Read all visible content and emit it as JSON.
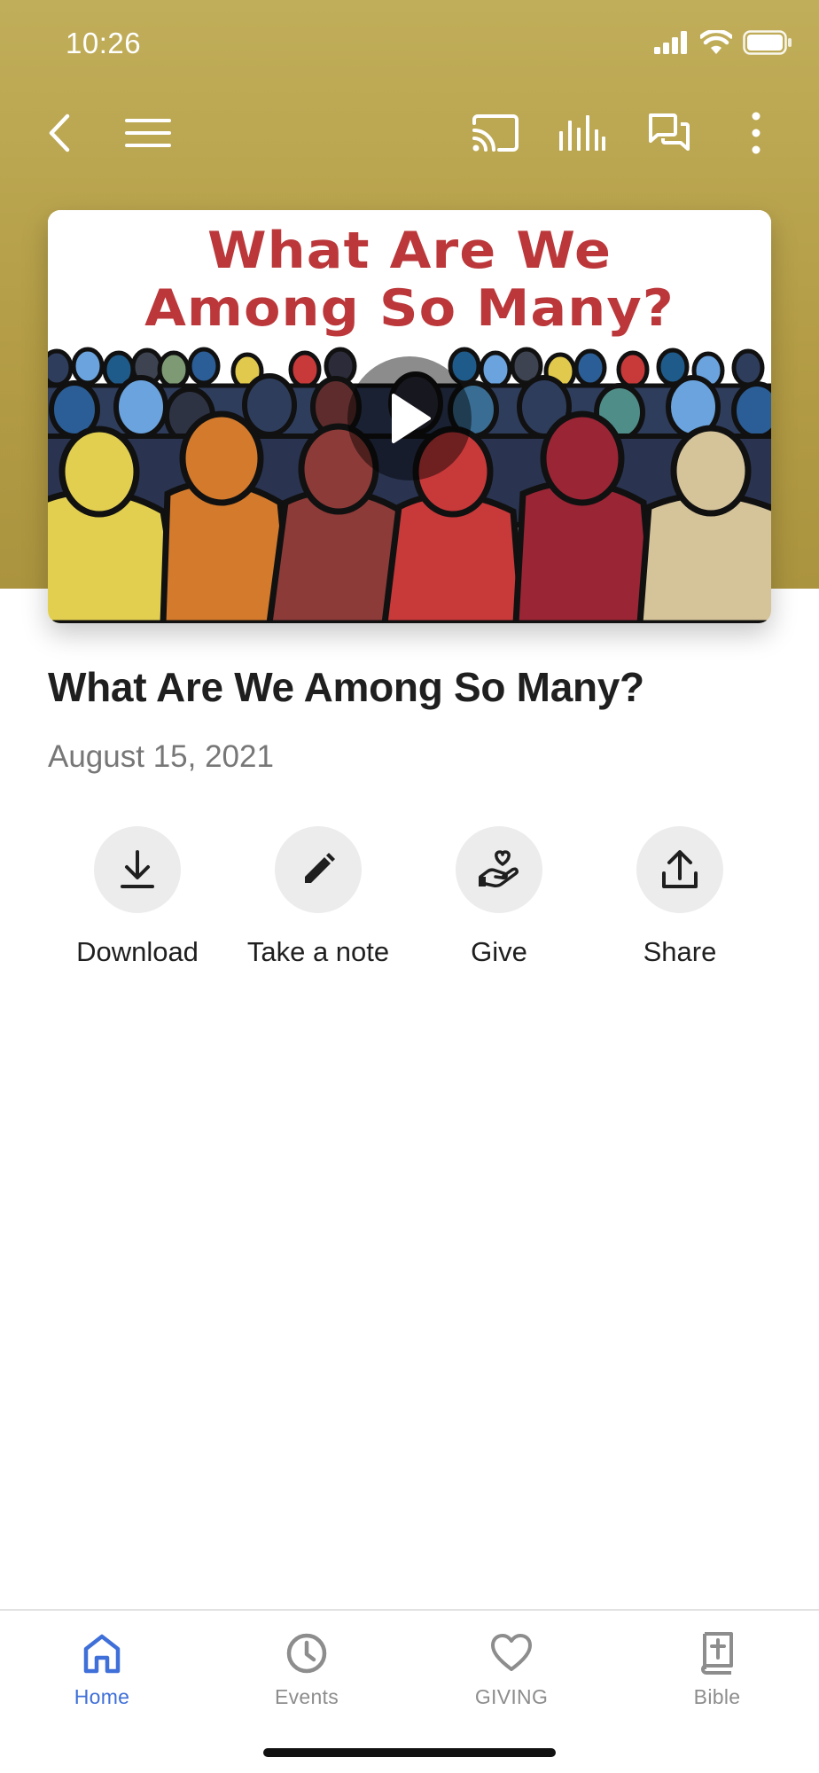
{
  "status_bar": {
    "time": "10:26"
  },
  "toolbar": {
    "back_icon": "chevron-left-icon",
    "menu_icon": "hamburger-menu-icon",
    "cast_icon": "cast-icon",
    "audio_icon": "audio-bars-icon",
    "chat_icon": "chat-bubbles-icon",
    "more_icon": "more-vertical-icon"
  },
  "video": {
    "thumbnail_text_line1": "What Are We",
    "thumbnail_text_line2": "Among So Many?",
    "play_icon": "play-icon"
  },
  "sermon": {
    "title": "What Are We Among So Many?",
    "date": "August 15, 2021"
  },
  "actions": [
    {
      "label": "Download",
      "icon": "download-icon"
    },
    {
      "label": "Take a note",
      "icon": "pencil-icon"
    },
    {
      "label": "Give",
      "icon": "give-heart-hand-icon"
    },
    {
      "label": "Share",
      "icon": "share-icon"
    }
  ],
  "bottom_nav": {
    "items": [
      {
        "label": "Home",
        "icon": "home-icon",
        "active": true
      },
      {
        "label": "Events",
        "icon": "clock-icon",
        "active": false
      },
      {
        "label": "GIVING",
        "icon": "heart-icon",
        "active": false
      },
      {
        "label": "Bible",
        "icon": "bible-icon",
        "active": false
      }
    ]
  },
  "colors": {
    "header_gold": "#bba753",
    "thumbnail_title_red": "#bb373a",
    "active_blue": "#3f6fd8",
    "inactive_gray": "#8d8d8d"
  }
}
